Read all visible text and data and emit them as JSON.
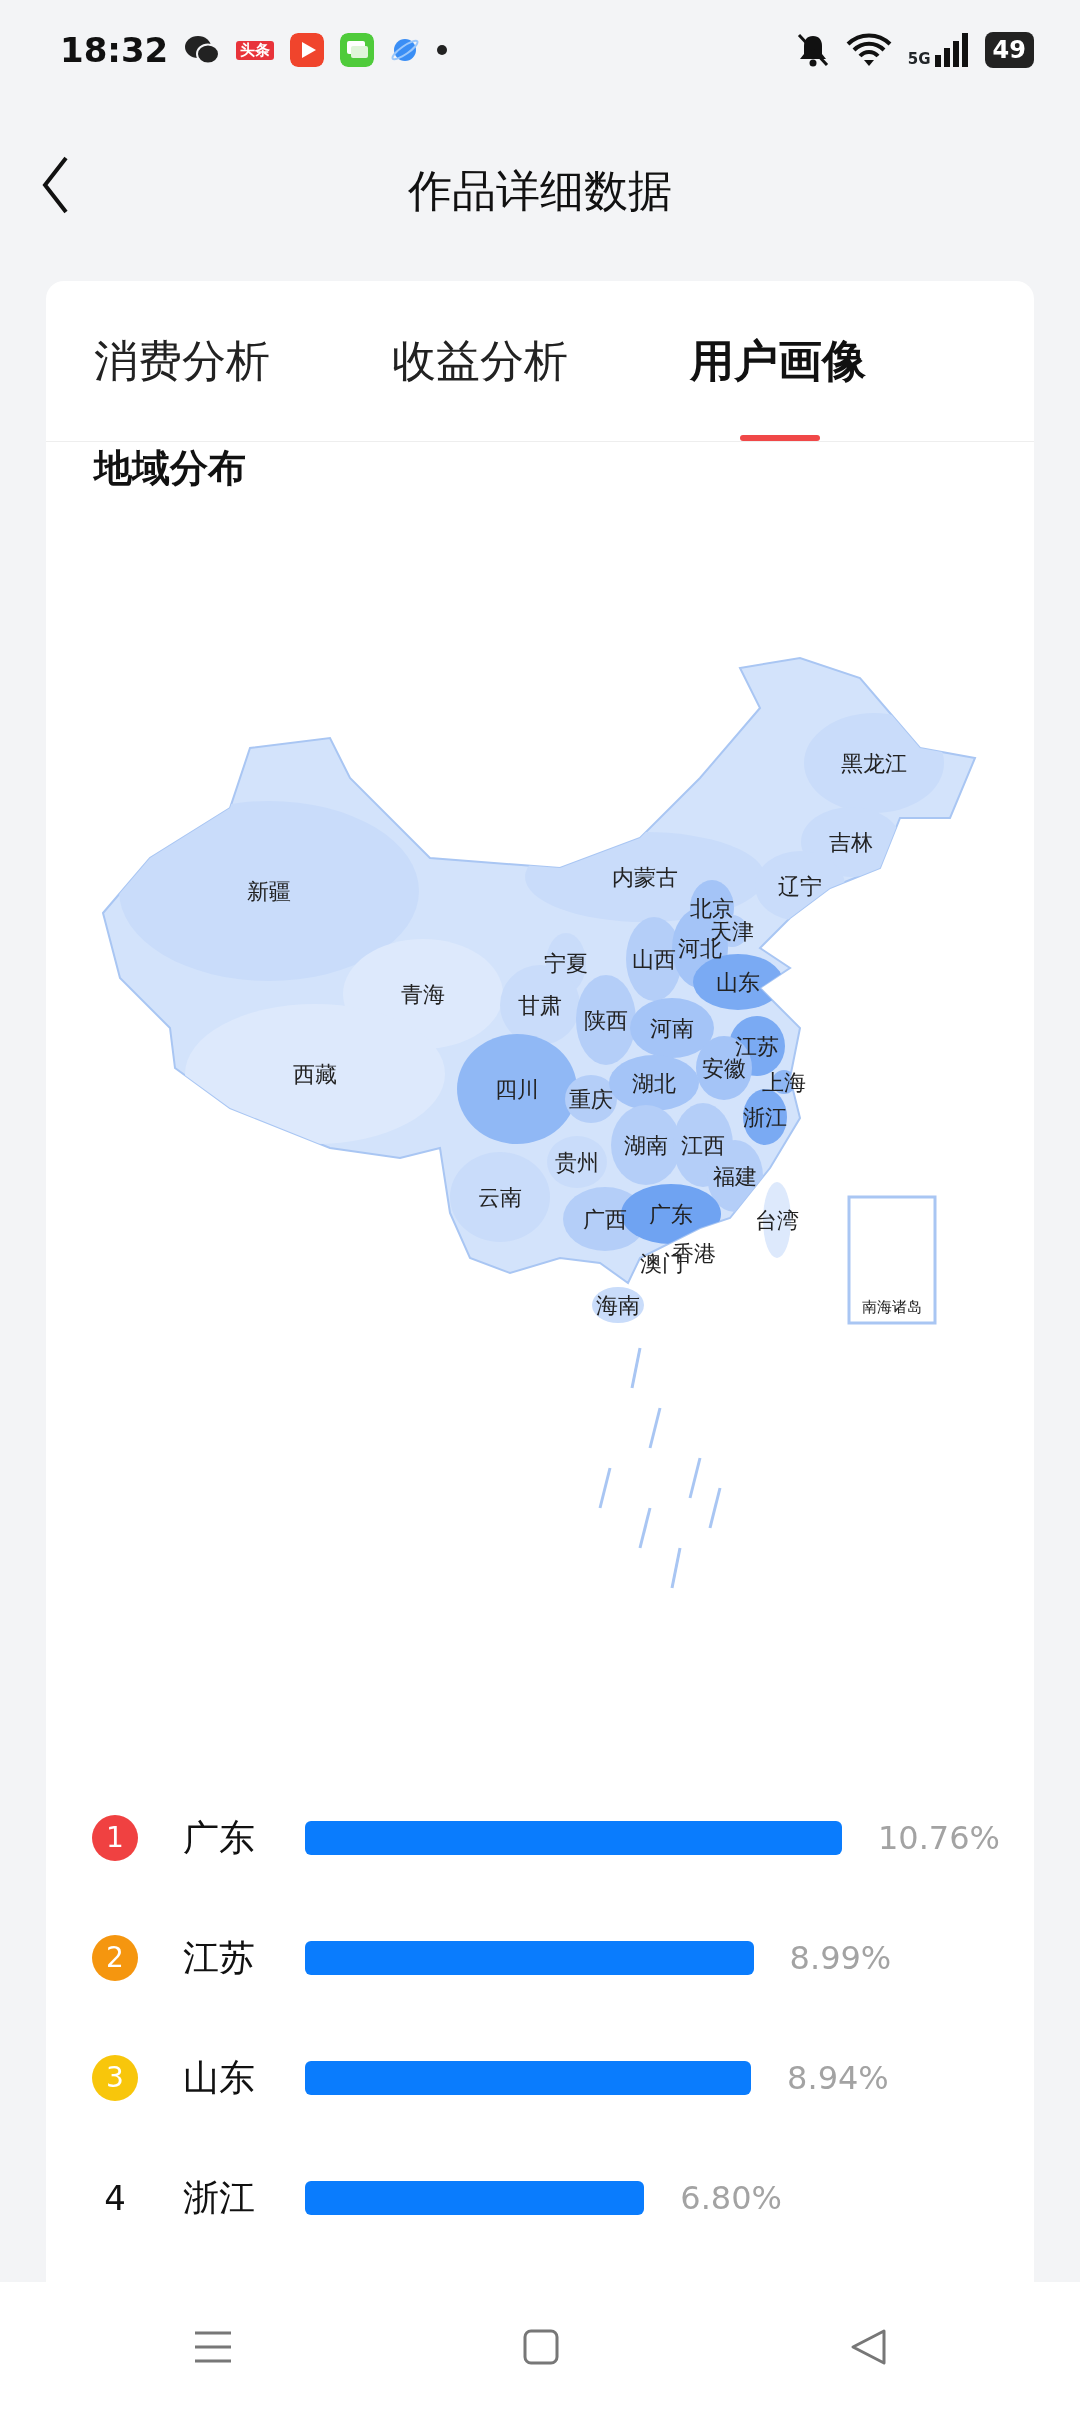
{
  "status_bar": {
    "time": "18:32",
    "news_badge": "头条",
    "network": "5G",
    "battery": "49"
  },
  "header": {
    "title": "作品详细数据"
  },
  "tabs": [
    {
      "label": "消费分析",
      "selected": false
    },
    {
      "label": "收益分析",
      "selected": false
    },
    {
      "label": "用户画像",
      "selected": true
    }
  ],
  "section_title": "地域分布",
  "map": {
    "regions": [
      {
        "name": "黑龙江",
        "color": "#c9dcfa"
      },
      {
        "name": "吉林",
        "color": "#c9dcfa"
      },
      {
        "name": "新疆",
        "color": "#c9dcfa"
      },
      {
        "name": "内蒙古",
        "color": "#c9dcfa"
      },
      {
        "name": "辽宁",
        "color": "#c9dcfa"
      },
      {
        "name": "北京",
        "color": "#a4c4f7"
      },
      {
        "name": "天津",
        "color": "#b4cef8"
      },
      {
        "name": "宁夏",
        "color": "#c9dcfa"
      },
      {
        "name": "山西",
        "color": "#b4cef8"
      },
      {
        "name": "河北",
        "color": "#a4c4f7"
      },
      {
        "name": "青海",
        "color": "#dde9fc"
      },
      {
        "name": "山东",
        "color": "#7aaaf3"
      },
      {
        "name": "甘肃",
        "color": "#c9dcfa"
      },
      {
        "name": "陕西",
        "color": "#b4cef8"
      },
      {
        "name": "河南",
        "color": "#a4c4f7"
      },
      {
        "name": "江苏",
        "color": "#7aaaf3"
      },
      {
        "name": "西藏",
        "color": "#dde9fc"
      },
      {
        "name": "安徽",
        "color": "#a4c4f7"
      },
      {
        "name": "四川",
        "color": "#90b8f5"
      },
      {
        "name": "重庆",
        "color": "#b4cef8"
      },
      {
        "name": "湖北",
        "color": "#a4c4f7"
      },
      {
        "name": "上海",
        "color": "#8fb7f5"
      },
      {
        "name": "浙江",
        "color": "#7aaaf3"
      },
      {
        "name": "湖南",
        "color": "#b4cef8"
      },
      {
        "name": "江西",
        "color": "#b4cef8"
      },
      {
        "name": "贵州",
        "color": "#c9dcfa"
      },
      {
        "name": "福建",
        "color": "#b4cef8"
      },
      {
        "name": "云南",
        "color": "#c9dcfa"
      },
      {
        "name": "广西",
        "color": "#b4cef8"
      },
      {
        "name": "广东",
        "color": "#6fa3f2"
      },
      {
        "name": "台湾",
        "color": "#dde9fc"
      },
      {
        "name": "澳门"
      },
      {
        "name": "香港"
      },
      {
        "name": "海南",
        "color": "#c9dcfa"
      }
    ],
    "inset_label": "南海诸岛"
  },
  "ranking": [
    {
      "rank": "1",
      "color": "#f04141",
      "name": "广东",
      "percent": "10.76%"
    },
    {
      "rank": "2",
      "color": "#f5960f",
      "name": "江苏",
      "percent": "8.99%"
    },
    {
      "rank": "3",
      "color": "#f8c60b",
      "name": "山东",
      "percent": "8.94%"
    },
    {
      "rank": "4",
      "name": "浙江",
      "percent": "6.80%"
    }
  ]
}
